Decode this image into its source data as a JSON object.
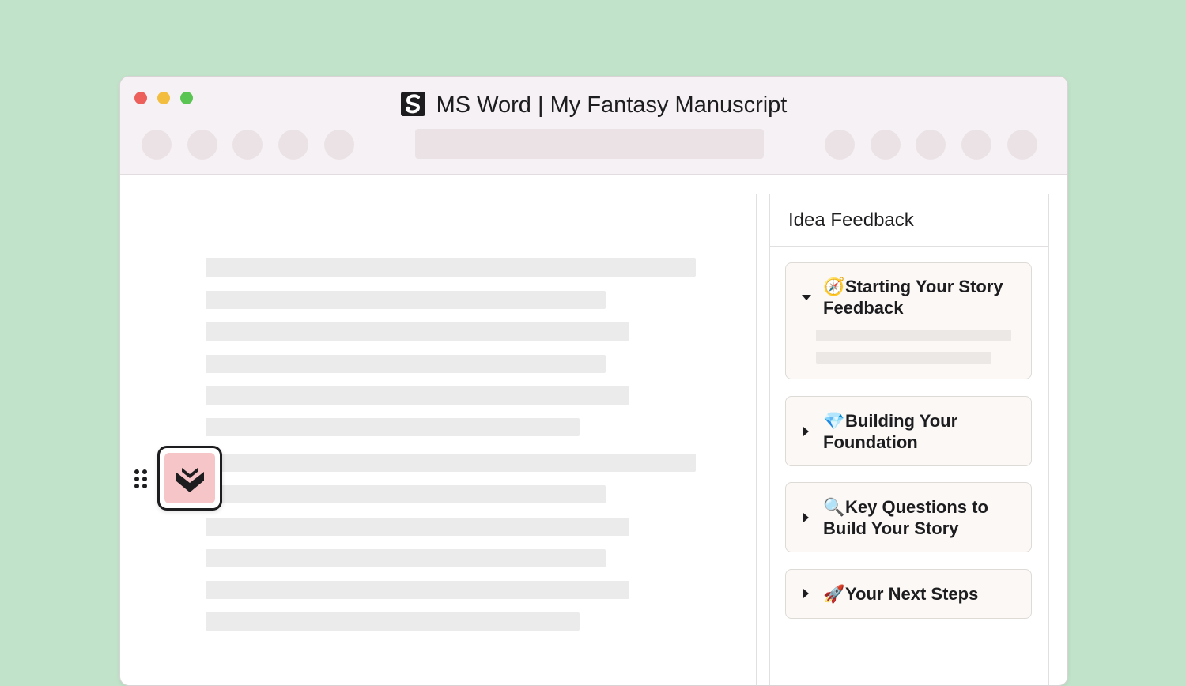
{
  "window": {
    "app_name": "MS Word",
    "separator": "|",
    "document_title": "My Fantasy Manuscript"
  },
  "icons": {
    "app_logo": "s-logo-icon",
    "badge": "book-heart-icon",
    "drag": "drag-handle-icon"
  },
  "colors": {
    "background": "#c0e3c9",
    "titlebar": "#f6f1f4",
    "badge_fill": "#f6c5c7",
    "close": "#ec5f5a",
    "minimize": "#f3bd3f",
    "maximize": "#5bc553"
  },
  "panel": {
    "title": "Idea Feedback",
    "cards": [
      {
        "emoji": "🧭",
        "title": "Starting Your Story Feedback",
        "expanded": true
      },
      {
        "emoji": "💎",
        "title": "Building Your Foundation",
        "expanded": false
      },
      {
        "emoji": "🔍",
        "title": "Key Questions to Build Your Story",
        "expanded": false
      },
      {
        "emoji": "🚀",
        "title": "Your Next Steps",
        "expanded": false
      }
    ]
  }
}
